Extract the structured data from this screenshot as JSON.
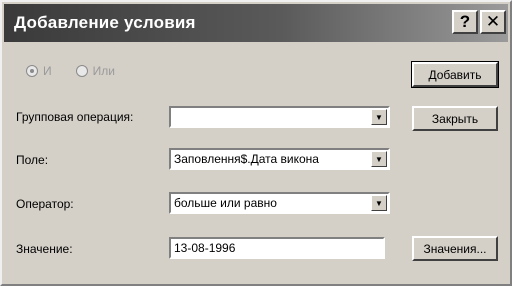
{
  "window": {
    "title": "Добавление условия",
    "help_glyph": "?",
    "close_glyph": "✕"
  },
  "logic": {
    "options": [
      {
        "label": "И",
        "checked": true
      },
      {
        "label": "Или",
        "checked": false
      }
    ]
  },
  "form": {
    "group_operation": {
      "label": "Групповая операция:",
      "value": ""
    },
    "field": {
      "label": "Поле:",
      "value": "Заповлення$.Дата викона"
    },
    "operator": {
      "label": "Оператор:",
      "value": "больше или равно"
    },
    "value": {
      "label": "Значение:",
      "value": "13-08-1996"
    }
  },
  "buttons": {
    "add": "Добавить",
    "close": "Закрыть",
    "values": "Значения..."
  },
  "icons": {
    "dropdown": "▼"
  }
}
